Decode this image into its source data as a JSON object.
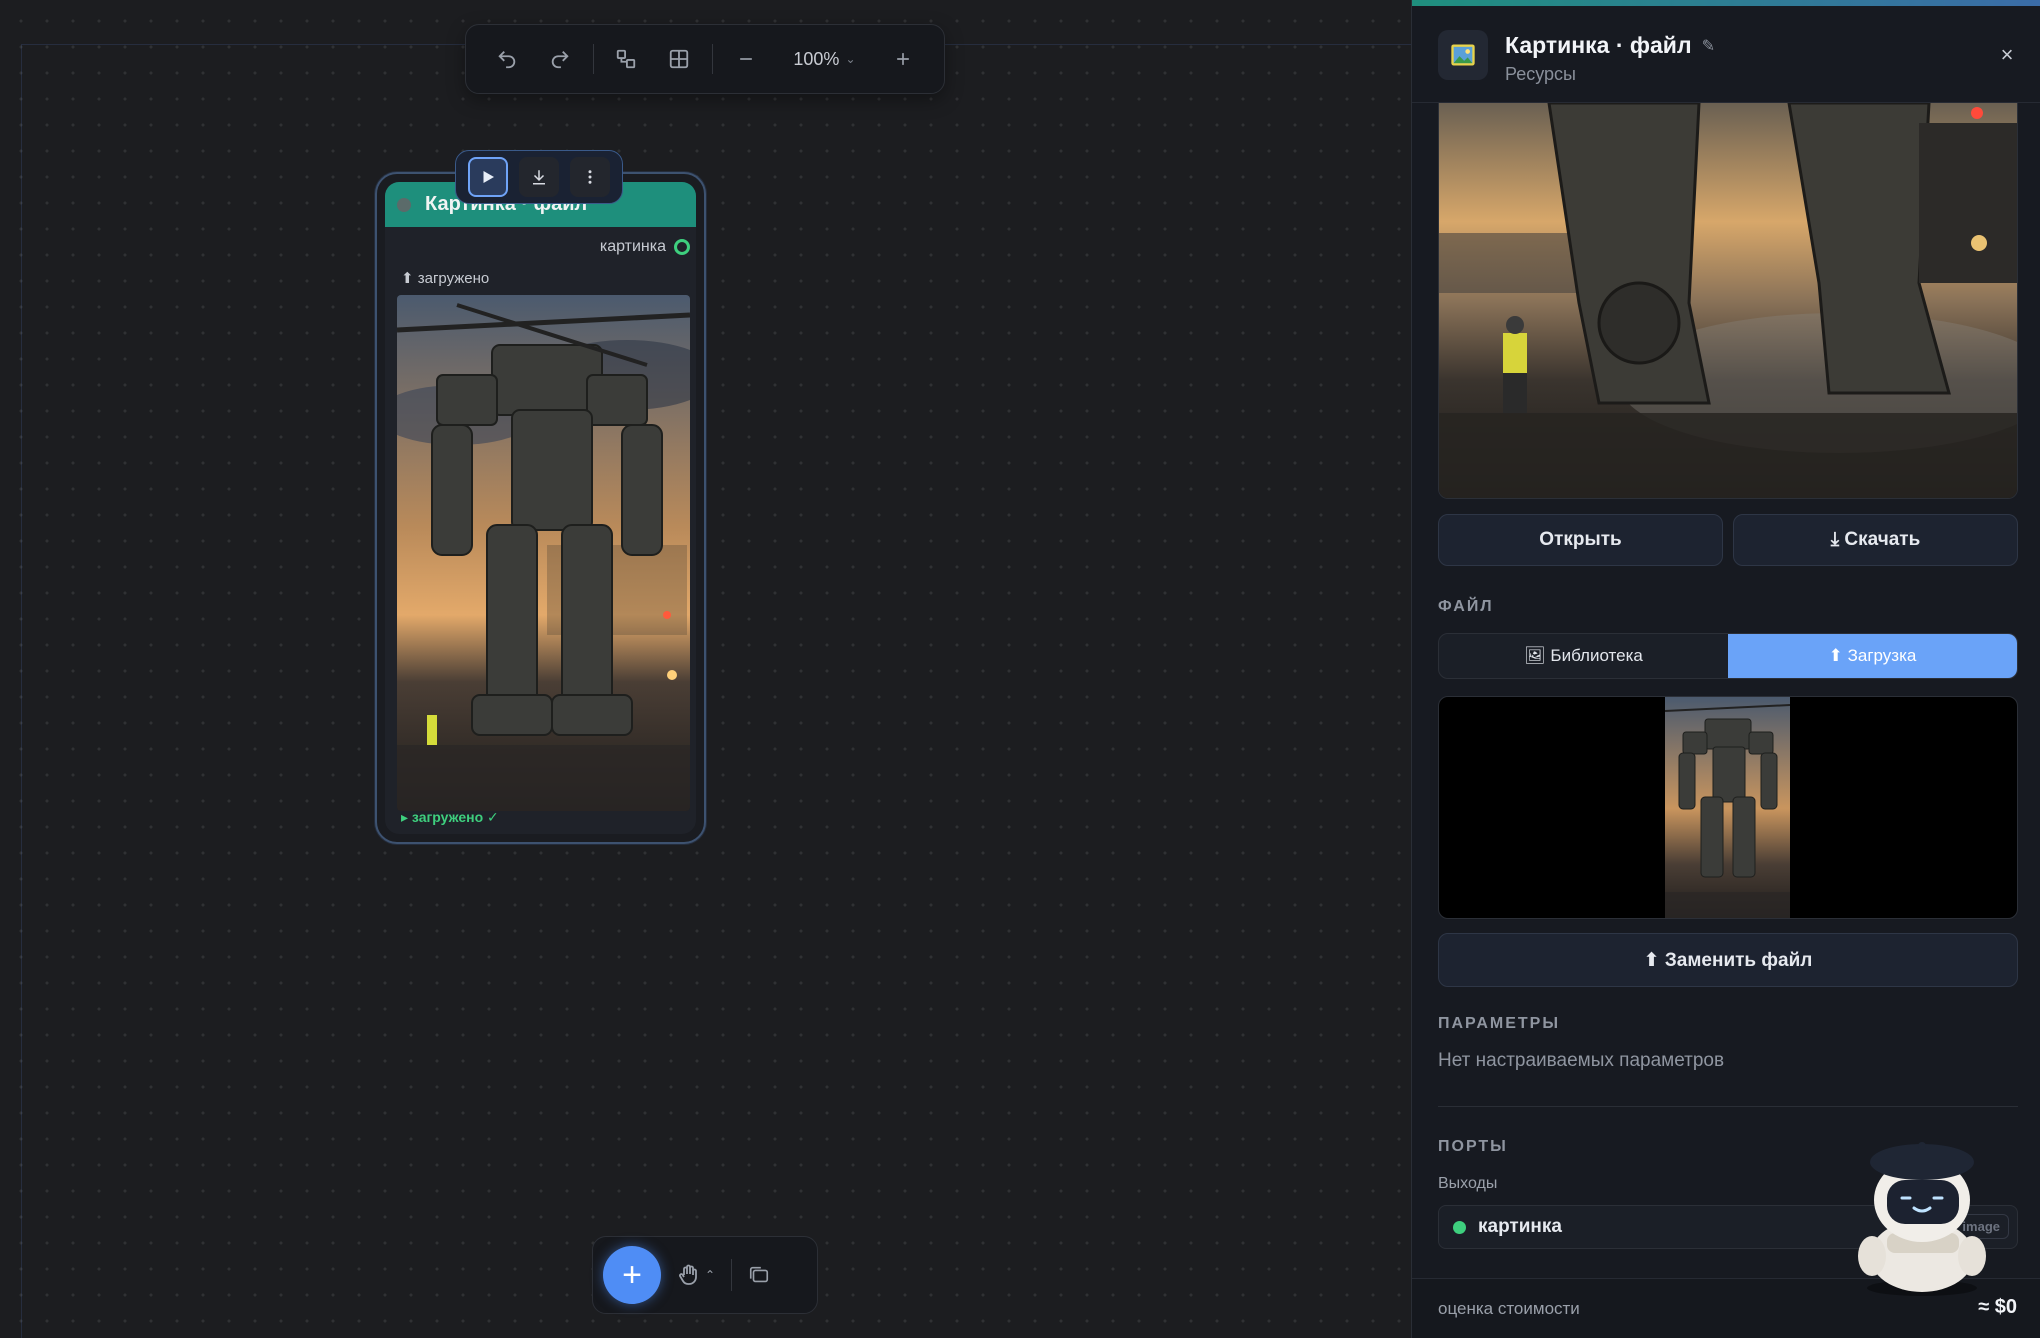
{
  "toolbar": {
    "zoom_label": "100%",
    "icons": [
      "undo-icon",
      "redo-icon",
      "group-icon",
      "grid-icon",
      "zoom-out-icon",
      "zoom-in-icon"
    ]
  },
  "node": {
    "title": "Картинка · файл",
    "output_port_label": "картинка",
    "status_upload": "⬆ загружено",
    "footer_status": "▸ загружено ✓",
    "actions": [
      "run-icon",
      "download-icon",
      "more-icon"
    ]
  },
  "bottom_bar": {
    "add_label": "+",
    "icons": [
      "hand-icon",
      "folder-icon"
    ]
  },
  "panel": {
    "title": "Картинка · файл",
    "edit_glyph": "✎",
    "subtitle": "Ресурсы",
    "close_glyph": "×",
    "open_label": "Открыть",
    "download_label": "⤓ Скачать",
    "file_section": "ФАЙЛ",
    "tab_library": "🖼 Библиотека",
    "tab_upload": "⬆ Загрузка",
    "replace_label": "⬆ Заменить файл",
    "params_section": "ПАРАМЕТРЫ",
    "no_params": "Нет настраиваемых параметров",
    "ports_section": "ПОРТЫ",
    "outputs_label": "Выходы",
    "output_port": "картинка",
    "output_port_tag": "image",
    "cost_label": "оценка стоимости",
    "cost_value": "≈ $0"
  },
  "colors": {
    "accent": "#4f8df5",
    "node_header": "#1e8f7c",
    "port_ok": "#3ecf7e",
    "tab_active": "#6aa3f8"
  }
}
